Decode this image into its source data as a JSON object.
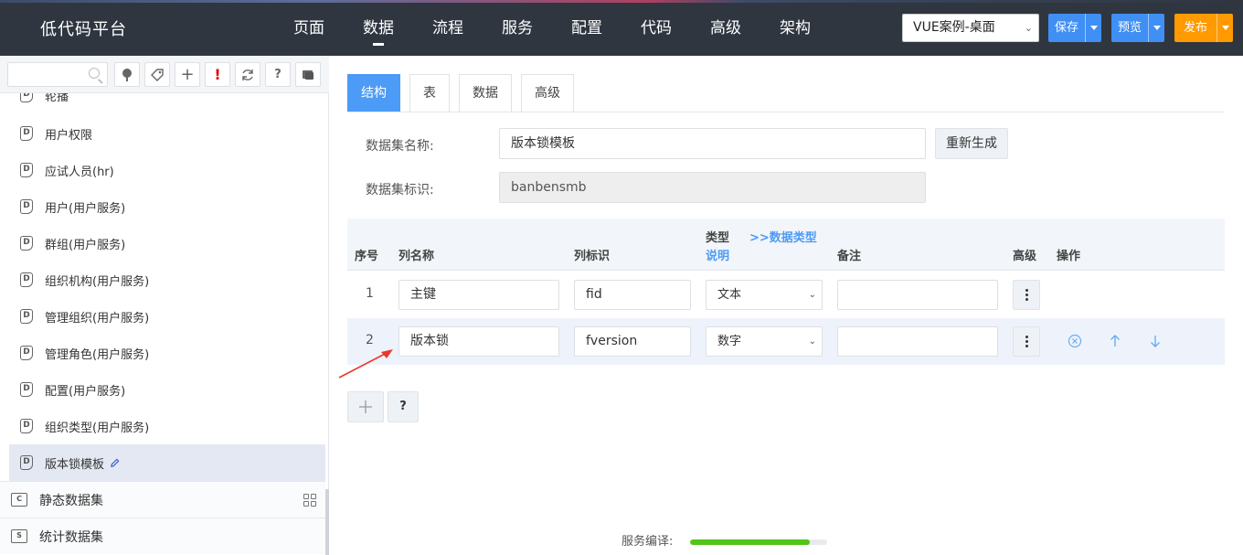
{
  "header": {
    "brand": "低代码平台",
    "nav": [
      "页面",
      "数据",
      "流程",
      "服务",
      "配置",
      "代码",
      "高级",
      "架构"
    ],
    "active_nav": 1,
    "app_select": "VUE案例-桌面",
    "save_label": "保存",
    "preview_label": "预览",
    "publish_label": "发布",
    "colors": {
      "bar": "#2f3640",
      "blue": "#3f8ff5",
      "orange": "#ff9a00"
    }
  },
  "sidebar": {
    "search_placeholder": "",
    "toolbar_icons": [
      "tree-icon",
      "tag-icon",
      "plus-icon",
      "exclamation-icon",
      "refresh-icon",
      "question-icon",
      "comment-icon"
    ],
    "toolbar_plus": "+",
    "toolbar_exclaim": "!",
    "toolbar_question": "?",
    "items": [
      {
        "label": "轮播"
      },
      {
        "label": "用户权限"
      },
      {
        "label": "应试人员(hr)"
      },
      {
        "label": "用户(用户服务)"
      },
      {
        "label": "群组(用户服务)"
      },
      {
        "label": "组织机构(用户服务)"
      },
      {
        "label": "管理组织(用户服务)"
      },
      {
        "label": "管理角色(用户服务)"
      },
      {
        "label": "配置(用户服务)"
      },
      {
        "label": "组织类型(用户服务)"
      },
      {
        "label": "版本锁模板"
      }
    ],
    "item_icon_letter": "D",
    "groups": [
      {
        "label": "静态数据集",
        "icon_letter": "C"
      },
      {
        "label": "统计数据集",
        "icon_letter": "S"
      }
    ]
  },
  "main": {
    "tabs": [
      "结构",
      "表",
      "数据",
      "高级"
    ],
    "active_tab": 0,
    "form": {
      "name_label": "数据集名称:",
      "name_value": "版本锁模板",
      "regen_label": "重新生成",
      "id_label": "数据集标识:",
      "id_value": "banbensmb"
    },
    "table": {
      "headers": {
        "seq": "序号",
        "col_name": "列名称",
        "col_id": "列标识",
        "type_line1": "类型",
        "type_link": ">>数据类型",
        "type_line2": "说明",
        "remark": "备注",
        "advanced": "高级",
        "actions": "操作"
      },
      "rows": [
        {
          "seq": "1",
          "name": "主键",
          "id": "fid",
          "type": "文本",
          "remark": ""
        },
        {
          "seq": "2",
          "name": "版本锁",
          "id": "fversion",
          "type": "数字",
          "remark": ""
        }
      ]
    },
    "help_label": "?"
  },
  "footer": {
    "status_label": "服务编译:",
    "progress_percent": 87
  }
}
